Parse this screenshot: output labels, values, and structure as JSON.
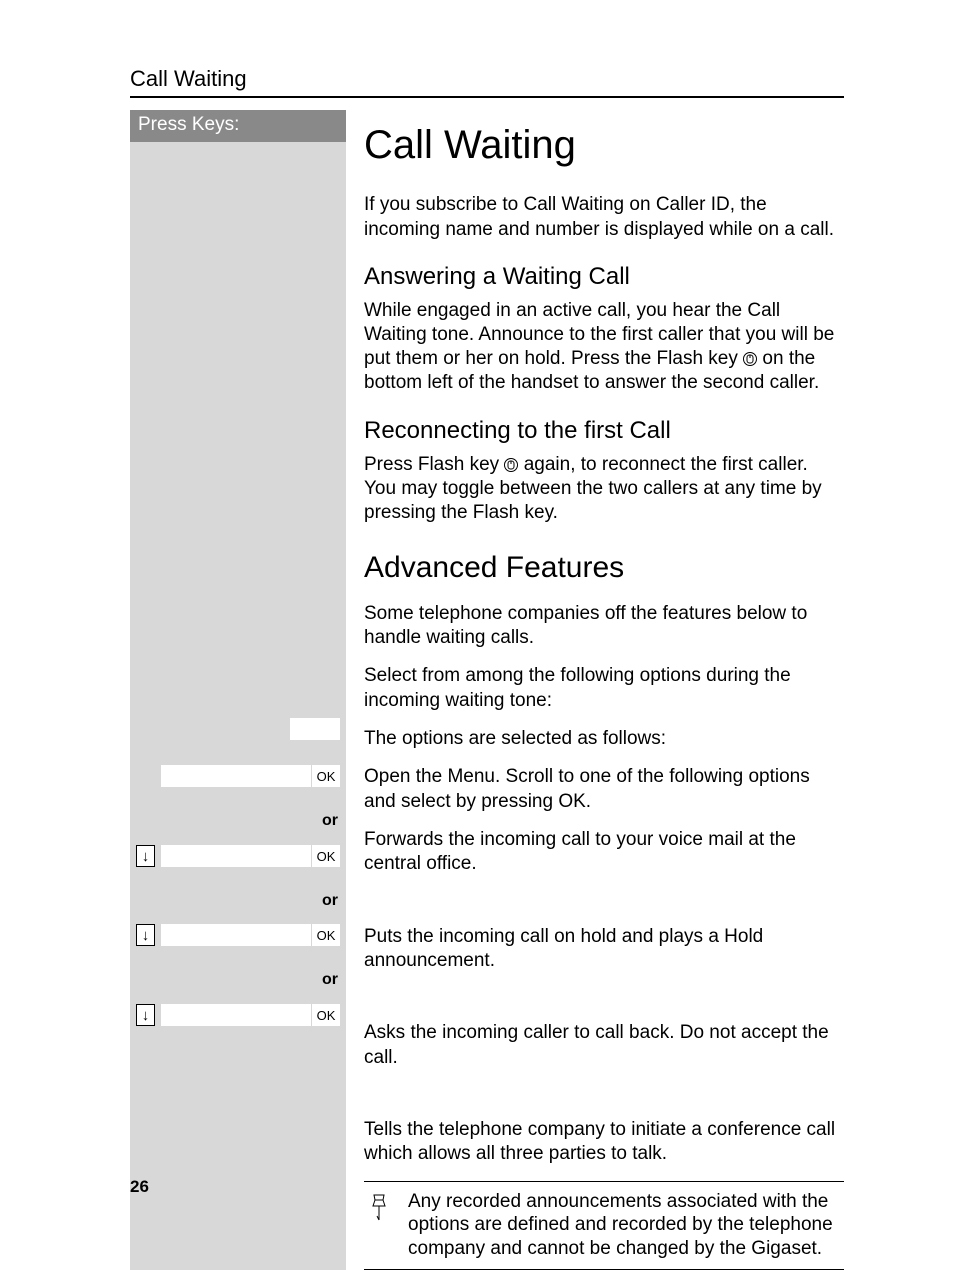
{
  "running_head": "Call Waiting",
  "sidebar_header": "Press Keys:",
  "title": "Call Waiting",
  "intro": "If you subscribe to Call Waiting on Caller ID, the incoming name and number is displayed while on a call.",
  "answering": {
    "heading": "Answering a Waiting Call",
    "body_before_icon": "While engaged in an active call, you hear the Call Waiting tone. Announce to the first caller that you will be put them or her on hold. Press the Flash key ",
    "body_after_icon": " on the bottom left of the handset to answer the second caller."
  },
  "reconnecting": {
    "heading": "Reconnecting to the first Call",
    "body_before_icon": "Press Flash key ",
    "body_after_icon": " again, to reconnect the first caller. You may toggle between the two callers at any time by pressing the Flash key."
  },
  "advanced": {
    "heading": "Advanced Features",
    "p1": "Some telephone companies off the features below to handle waiting calls.",
    "p2": "Select from among the following options during the incoming waiting tone:",
    "p3": "The options are selected as follows:",
    "open_menu": "Open the Menu. Scroll to one of the following options and select by pressing OK.",
    "opt1": "Forwards the incoming call to your voice mail at the central office.",
    "opt2": "Puts the incoming call on hold and plays a Hold announcement.",
    "opt3": "Asks the incoming caller to call back. Do not accept the call.",
    "opt4": "Tells the telephone company to initiate a conference call which allows all three parties to talk."
  },
  "connectors": {
    "or": "or",
    "ok": "OK",
    "down_arrow": "↓"
  },
  "note": "Any recorded announcements associated with the options are defined and recorded by the telephone company and cannot be changed by the Gigaset.",
  "page_number": "26"
}
